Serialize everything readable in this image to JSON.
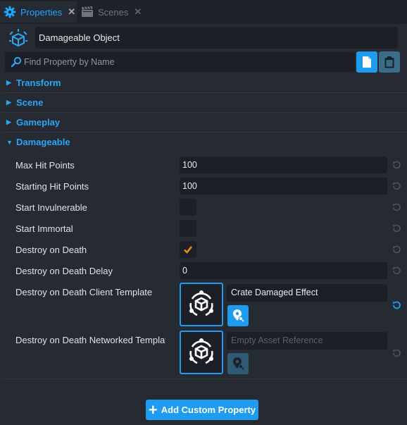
{
  "tabs": [
    {
      "label": "Properties",
      "icon": "gear-icon",
      "close": "✕"
    },
    {
      "label": "Scenes",
      "icon": "clapperboard-icon",
      "close": "✕"
    }
  ],
  "header": {
    "object_name": "Damageable Object",
    "object_icon": "damageable-object-icon",
    "search_placeholder": "Find Property by Name"
  },
  "sections": [
    {
      "label": "Transform",
      "expanded": false
    },
    {
      "label": "Scene",
      "expanded": false
    },
    {
      "label": "Gameplay",
      "expanded": false
    },
    {
      "label": "Damageable",
      "expanded": true
    }
  ],
  "properties": {
    "max_hit_points": {
      "label": "Max Hit Points",
      "value": "100"
    },
    "starting_hit_points": {
      "label": "Starting Hit Points",
      "value": "100"
    },
    "start_invulnerable": {
      "label": "Start Invulnerable",
      "checked": false
    },
    "start_immortal": {
      "label": "Start Immortal",
      "checked": false
    },
    "destroy_on_death": {
      "label": "Destroy on Death",
      "checked": true
    },
    "destroy_on_death_delay": {
      "label": "Destroy on Death Delay",
      "value": "0"
    },
    "client_template": {
      "label": "Destroy on Death Client Template",
      "value": "Crate Damaged Effect"
    },
    "networked_template": {
      "label": "Destroy on Death Networked Templat",
      "placeholder": "Empty Asset Reference"
    }
  },
  "footer": {
    "add_label": "Add Custom Property"
  },
  "colors": {
    "accent": "#1e9cf0",
    "section": "#2aa6f5",
    "check": "#e08a1e",
    "background": "#262a32"
  }
}
